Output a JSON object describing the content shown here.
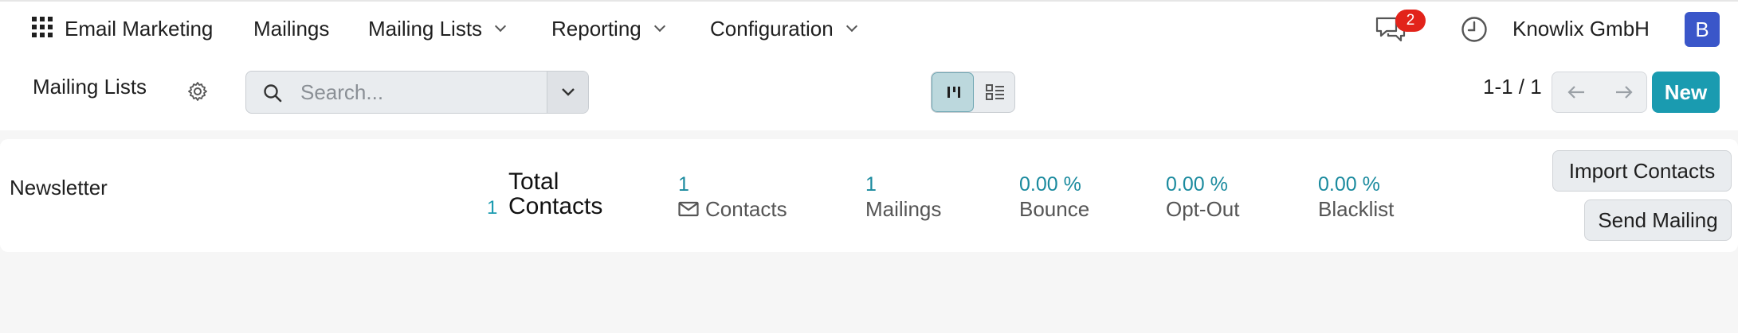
{
  "navbar": {
    "app_name": "Email Marketing",
    "menu": [
      {
        "label": "Mailings",
        "dropdown": false
      },
      {
        "label": "Mailing Lists",
        "dropdown": true
      },
      {
        "label": "Reporting",
        "dropdown": true
      },
      {
        "label": "Configuration",
        "dropdown": true
      }
    ],
    "message_badge": "2",
    "company": "Knowlix GmbH",
    "avatar_letter": "B"
  },
  "control_panel": {
    "breadcrumb": "Mailing Lists",
    "search_placeholder": "Search...",
    "pager_value": "1-1 / 1",
    "new_label": "New"
  },
  "record": {
    "name": "Newsletter",
    "total_contacts_count": "1",
    "total_contacts_label_line1": "Total",
    "total_contacts_label_line2": "Contacts",
    "stats": [
      {
        "value": "1",
        "label": "Contacts",
        "icon": "envelope-icon"
      },
      {
        "value": "1",
        "label": "Mailings"
      },
      {
        "value": "0.00 %",
        "label": "Bounce"
      },
      {
        "value": "0.00 %",
        "label": "Opt-Out"
      },
      {
        "value": "0.00 %",
        "label": "Blacklist"
      }
    ],
    "import_label": "Import Contacts",
    "send_label": "Send Mailing"
  },
  "colors": {
    "accent": "#1a9bb0",
    "badge": "#e2231a",
    "avatar": "#3a56c9"
  }
}
